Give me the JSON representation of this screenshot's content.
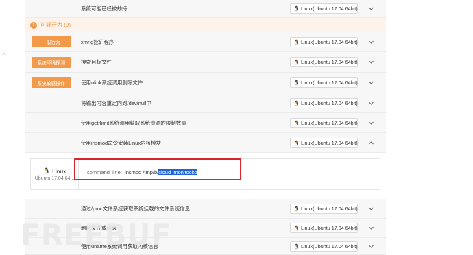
{
  "section": {
    "title": "可疑行为 (9)",
    "icon": "warning-icon",
    "accent": "#f2994a"
  },
  "rows": [
    {
      "tag": "",
      "desc": "系统可能已经被劫持",
      "os": "Linux(Ubuntu 17.04 64bit)",
      "expanded": false
    },
    {
      "tag": "一般行为",
      "desc": "xmrig挖矿程序",
      "os": "Linux(Ubuntu 17.04 64bit)",
      "expanded": false
    },
    {
      "tag": "系统环境探测",
      "desc": "搜索目标文件",
      "os": "Linux(Ubuntu 17.04 64bit)",
      "expanded": false
    },
    {
      "tag": "系统敏感操作",
      "desc": "使用ulink系统调用删除文件",
      "os": "Linux(Ubuntu 17.04 64bit)",
      "expanded": false
    },
    {
      "tag": "",
      "desc": "将输出内容重定向到/dev/null中",
      "os": "Linux(Ubuntu 17.04 64bit)",
      "expanded": false
    },
    {
      "tag": "",
      "desc": "使用getrlimit系统调用获取系统资源的限制数量",
      "os": "Linux(Ubuntu 17.04 64bit)",
      "expanded": false
    },
    {
      "tag": "",
      "desc": "使用insmod命令安装Linux内核模块",
      "os": "Linux(Ubuntu 17.04 64bit)",
      "expanded": true
    },
    {
      "tag": "",
      "desc": "通过/proc文件系统获取系统挂载的文件系统信息",
      "os": "Linux(Ubuntu 17.04 64bit)",
      "expanded": false
    },
    {
      "tag": "",
      "desc": "删除文件或目录",
      "os": "Linux(Ubuntu 17.04 64bit)",
      "expanded": false
    },
    {
      "tag": "",
      "desc": "使用uname系统调用获取内核信息",
      "os": "Linux(Ubuntu 17.04 64bit)",
      "expanded": false
    }
  ],
  "detail": {
    "os_name": "Linux",
    "os_version": "Ubuntu 17.04 64...",
    "command_key": "command_line:",
    "command_prefix": "insmod /tmp/b/",
    "command_highlight": "cloud_monitocko"
  },
  "watermark": "FREEBUF",
  "colors": {
    "tag_bg": "#f2994a",
    "highlight": "#1f64d6",
    "annotation": "#d9262b"
  }
}
